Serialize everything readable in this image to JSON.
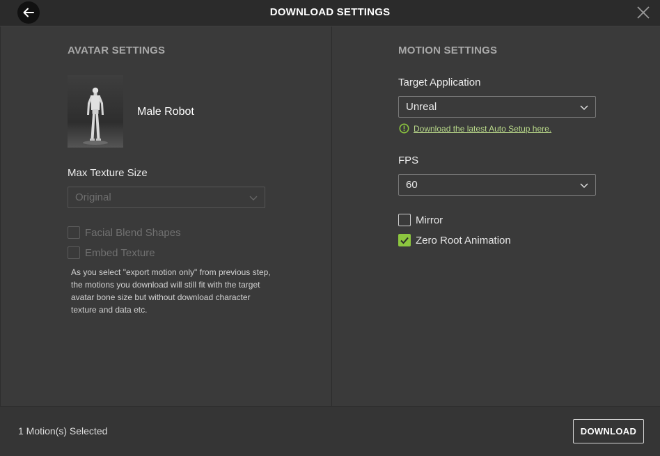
{
  "header": {
    "title": "DOWNLOAD SETTINGS",
    "back_icon": "arrow-left-icon",
    "close_icon": "close-icon"
  },
  "avatar_settings": {
    "title": "AVATAR SETTINGS",
    "avatar_name": "Male Robot",
    "max_texture_size": {
      "label": "Max Texture Size",
      "selected": "Original",
      "disabled": true
    },
    "options": [
      {
        "label": "Facial Blend Shapes",
        "checked": false,
        "disabled": true
      },
      {
        "label": "Embed Texture",
        "checked": false,
        "disabled": true
      }
    ],
    "note": "As you select \"export motion only\" from previous step, the motions you download will still fit with the target avatar bone size but without download character texture and data etc."
  },
  "motion_settings": {
    "title": "MOTION SETTINGS",
    "target_application": {
      "label": "Target Application",
      "selected": "Unreal"
    },
    "auto_setup_link": "Download the latest Auto Setup here.",
    "fps": {
      "label": "FPS",
      "selected": "60"
    },
    "options": [
      {
        "label": "Mirror",
        "checked": false
      },
      {
        "label": "Zero Root Animation",
        "checked": true
      }
    ]
  },
  "footer": {
    "status": "1 Motion(s) Selected",
    "download_label": "DOWNLOAD"
  },
  "colors": {
    "accent_green": "#8cc63f",
    "background": "#3a3a3a",
    "header": "#2b2b2b"
  }
}
